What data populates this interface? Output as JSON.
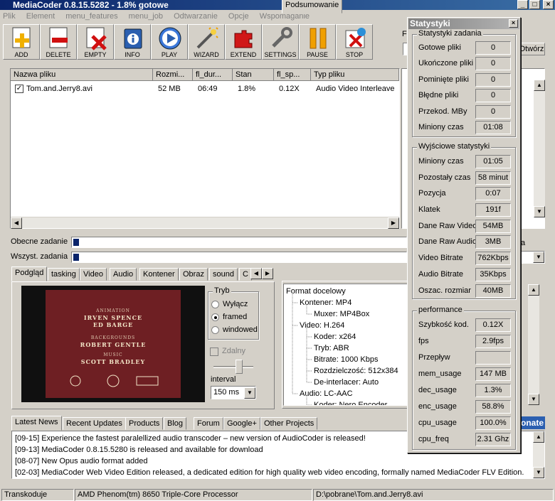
{
  "window": {
    "title": "MediaCoder 0.8.15.5282 -  1.8% gotowe"
  },
  "menu": [
    "Plik",
    "Element",
    "menu_features",
    "menu_job",
    "Odtwarzanie",
    "Opcje",
    "Wspomaganie"
  ],
  "toolbar": [
    {
      "label": "ADD",
      "icon": "add-icon"
    },
    {
      "label": "DELETE",
      "icon": "delete-icon"
    },
    {
      "label": "EMPTY",
      "icon": "empty-icon"
    },
    {
      "label": "INFO",
      "icon": "info-icon"
    },
    {
      "label": "PLAY",
      "icon": "play-icon"
    },
    {
      "label": "WIZARD",
      "icon": "wizard-icon"
    },
    {
      "label": "EXTEND",
      "icon": "extend-icon"
    },
    {
      "label": "SETTINGS",
      "icon": "settings-icon"
    },
    {
      "label": "PAUSE",
      "icon": "pause-icon"
    },
    {
      "label": "STOP",
      "icon": "stop-icon"
    }
  ],
  "filelist": {
    "columns": [
      "Nazwa pliku",
      "Rozmi...",
      "fl_dur...",
      "Stan",
      "fl_sp...",
      "Typ pliku"
    ],
    "rows": [
      {
        "name": "Tom.and.Jerry8.avi",
        "size": "52 MB",
        "duration": "06:49",
        "state": "1.8%",
        "speed": "0.12X",
        "type": "Audio Video Interleave",
        "checked": true
      }
    ]
  },
  "right_partial": {
    "label_f": "F",
    "open_button": "Otwórz",
    "label_a": "a"
  },
  "progress": {
    "current_label": "Obecne zadanie",
    "current_value": 1.8,
    "total_label": "Wszyst. zadania",
    "total_value": 1.8
  },
  "tabs_left": [
    "Podgląd",
    "tasking",
    "Video",
    "Audio",
    "Kontener",
    "Obraz",
    "sound",
    "C"
  ],
  "preview": {
    "credits": [
      {
        "t": "ANIMATION",
        "s": "small"
      },
      {
        "t": "IRVEN SPENCE",
        "s": "big"
      },
      {
        "t": "ED BARGE",
        "s": "big"
      },
      {
        "t": "BACKGROUNDS",
        "s": "small"
      },
      {
        "t": "ROBERT GENTLE",
        "s": "big"
      },
      {
        "t": "MUSIC",
        "s": "small"
      },
      {
        "t": "SCOTT BRADLEY",
        "s": "big"
      }
    ],
    "mode_group": "Tryb",
    "modes": [
      "Wyłącz",
      "framed",
      "windowed"
    ],
    "selected_mode": "framed",
    "remote_label": "Zdalny",
    "interval_label": "interval",
    "interval_value": "150 ms"
  },
  "summary": {
    "tab": "Podsumowanie",
    "tree": [
      {
        "t": "Format docelowy",
        "lvl": 0
      },
      {
        "t": "Kontener: MP4",
        "lvl": 1
      },
      {
        "t": "Muxer: MP4Box",
        "lvl": 2
      },
      {
        "t": "Video: H.264",
        "lvl": 1
      },
      {
        "t": "Koder: x264",
        "lvl": 2
      },
      {
        "t": "Tryb: ABR",
        "lvl": 2
      },
      {
        "t": "Bitrate: 1000 Kbps",
        "lvl": 2
      },
      {
        "t": "Rozdzielczość: 512x384",
        "lvl": 2
      },
      {
        "t": "De-interlacer: Auto",
        "lvl": 2
      },
      {
        "t": "Audio: LC-AAC",
        "lvl": 1
      },
      {
        "t": "Koder: Nero Encoder",
        "lvl": 2
      }
    ]
  },
  "news": {
    "tabs": [
      "Latest News",
      "Recent Updates",
      "Products",
      "Blog",
      "Forum",
      "Google+",
      "Other Projects"
    ],
    "donate": "onate",
    "lines": [
      "[09-15] Experience the fastest paralellized audio transcoder – new version of AudioCoder is released!",
      "[09-13] MediaCoder 0.8.15.5280 is released and available for download",
      "[08-07] New Opus audio format added",
      "[02-03] MediaCoder Web Video Edition released, a dedicated edition for high quality web video encoding, formally named MediaCoder FLV Edition."
    ]
  },
  "statusbar": [
    "Transkoduje",
    "AMD Phenom(tm) 8650 Triple-Core Processor",
    "D:\\pobrane\\Tom.and.Jerry8.avi"
  ],
  "stats": {
    "title": "Statystyki",
    "groups": [
      {
        "title": "Statystyki zadania",
        "rows": [
          {
            "label": "Gotowe pliki",
            "value": "0"
          },
          {
            "label": "Ukończone pliki",
            "value": "0"
          },
          {
            "label": "Pominięte pliki",
            "value": "0"
          },
          {
            "label": "Błędne pliki",
            "value": "0"
          },
          {
            "label": "Przekod. MBy",
            "value": "0"
          },
          {
            "label": "Miniony czas",
            "value": "01:08"
          }
        ]
      },
      {
        "title": "Wyjściowe statystyki",
        "rows": [
          {
            "label": "Miniony czas",
            "value": "01:05"
          },
          {
            "label": "Pozostały czas",
            "value": "58 minut"
          },
          {
            "label": "Pozycja",
            "value": "0:07"
          },
          {
            "label": "Klatek",
            "value": "191f"
          },
          {
            "label": "Dane Raw Video",
            "value": "54MB"
          },
          {
            "label": "Dane Raw Audio",
            "value": "3MB"
          },
          {
            "label": "Video Bitrate",
            "value": "762Kbps"
          },
          {
            "label": "Audio Bitrate",
            "value": "35Kbps"
          },
          {
            "label": "Oszac. rozmiar",
            "value": "40MB"
          }
        ]
      },
      {
        "title": "performance",
        "rows": [
          {
            "label": "Szybkość kod.",
            "value": "0.12X"
          },
          {
            "label": "fps",
            "value": "2.9fps"
          },
          {
            "label": "Przepływ",
            "value": ""
          },
          {
            "label": "mem_usage",
            "value": "147 MB"
          },
          {
            "label": "dec_usage",
            "value": "1.3%"
          },
          {
            "label": "enc_usage",
            "value": "58.8%"
          },
          {
            "label": "cpu_usage",
            "value": "100.0%"
          },
          {
            "label": "cpu_freq",
            "value": "2.31 Ghz"
          }
        ]
      }
    ]
  }
}
